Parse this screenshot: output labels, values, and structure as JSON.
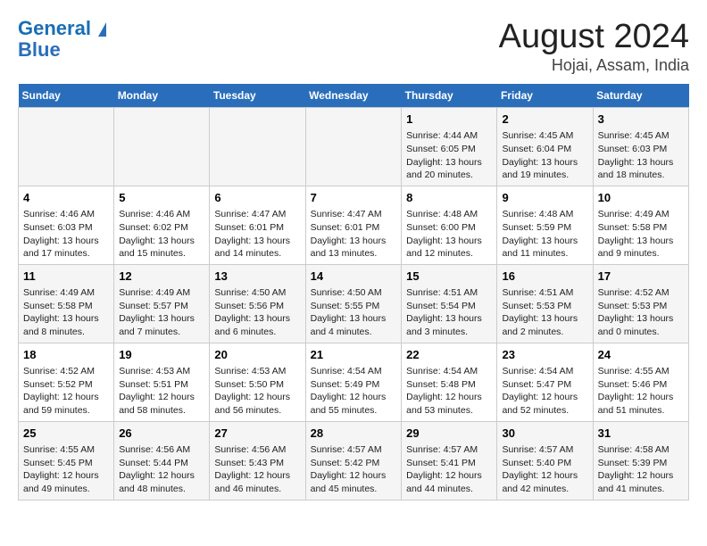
{
  "header": {
    "logo_line1": "General",
    "logo_line2": "Blue",
    "month": "August 2024",
    "location": "Hojai, Assam, India"
  },
  "weekdays": [
    "Sunday",
    "Monday",
    "Tuesday",
    "Wednesday",
    "Thursday",
    "Friday",
    "Saturday"
  ],
  "weeks": [
    [
      {
        "day": "",
        "info": ""
      },
      {
        "day": "",
        "info": ""
      },
      {
        "day": "",
        "info": ""
      },
      {
        "day": "",
        "info": ""
      },
      {
        "day": "1",
        "info": "Sunrise: 4:44 AM\nSunset: 6:05 PM\nDaylight: 13 hours\nand 20 minutes."
      },
      {
        "day": "2",
        "info": "Sunrise: 4:45 AM\nSunset: 6:04 PM\nDaylight: 13 hours\nand 19 minutes."
      },
      {
        "day": "3",
        "info": "Sunrise: 4:45 AM\nSunset: 6:03 PM\nDaylight: 13 hours\nand 18 minutes."
      }
    ],
    [
      {
        "day": "4",
        "info": "Sunrise: 4:46 AM\nSunset: 6:03 PM\nDaylight: 13 hours\nand 17 minutes."
      },
      {
        "day": "5",
        "info": "Sunrise: 4:46 AM\nSunset: 6:02 PM\nDaylight: 13 hours\nand 15 minutes."
      },
      {
        "day": "6",
        "info": "Sunrise: 4:47 AM\nSunset: 6:01 PM\nDaylight: 13 hours\nand 14 minutes."
      },
      {
        "day": "7",
        "info": "Sunrise: 4:47 AM\nSunset: 6:01 PM\nDaylight: 13 hours\nand 13 minutes."
      },
      {
        "day": "8",
        "info": "Sunrise: 4:48 AM\nSunset: 6:00 PM\nDaylight: 13 hours\nand 12 minutes."
      },
      {
        "day": "9",
        "info": "Sunrise: 4:48 AM\nSunset: 5:59 PM\nDaylight: 13 hours\nand 11 minutes."
      },
      {
        "day": "10",
        "info": "Sunrise: 4:49 AM\nSunset: 5:58 PM\nDaylight: 13 hours\nand 9 minutes."
      }
    ],
    [
      {
        "day": "11",
        "info": "Sunrise: 4:49 AM\nSunset: 5:58 PM\nDaylight: 13 hours\nand 8 minutes."
      },
      {
        "day": "12",
        "info": "Sunrise: 4:49 AM\nSunset: 5:57 PM\nDaylight: 13 hours\nand 7 minutes."
      },
      {
        "day": "13",
        "info": "Sunrise: 4:50 AM\nSunset: 5:56 PM\nDaylight: 13 hours\nand 6 minutes."
      },
      {
        "day": "14",
        "info": "Sunrise: 4:50 AM\nSunset: 5:55 PM\nDaylight: 13 hours\nand 4 minutes."
      },
      {
        "day": "15",
        "info": "Sunrise: 4:51 AM\nSunset: 5:54 PM\nDaylight: 13 hours\nand 3 minutes."
      },
      {
        "day": "16",
        "info": "Sunrise: 4:51 AM\nSunset: 5:53 PM\nDaylight: 13 hours\nand 2 minutes."
      },
      {
        "day": "17",
        "info": "Sunrise: 4:52 AM\nSunset: 5:53 PM\nDaylight: 13 hours\nand 0 minutes."
      }
    ],
    [
      {
        "day": "18",
        "info": "Sunrise: 4:52 AM\nSunset: 5:52 PM\nDaylight: 12 hours\nand 59 minutes."
      },
      {
        "day": "19",
        "info": "Sunrise: 4:53 AM\nSunset: 5:51 PM\nDaylight: 12 hours\nand 58 minutes."
      },
      {
        "day": "20",
        "info": "Sunrise: 4:53 AM\nSunset: 5:50 PM\nDaylight: 12 hours\nand 56 minutes."
      },
      {
        "day": "21",
        "info": "Sunrise: 4:54 AM\nSunset: 5:49 PM\nDaylight: 12 hours\nand 55 minutes."
      },
      {
        "day": "22",
        "info": "Sunrise: 4:54 AM\nSunset: 5:48 PM\nDaylight: 12 hours\nand 53 minutes."
      },
      {
        "day": "23",
        "info": "Sunrise: 4:54 AM\nSunset: 5:47 PM\nDaylight: 12 hours\nand 52 minutes."
      },
      {
        "day": "24",
        "info": "Sunrise: 4:55 AM\nSunset: 5:46 PM\nDaylight: 12 hours\nand 51 minutes."
      }
    ],
    [
      {
        "day": "25",
        "info": "Sunrise: 4:55 AM\nSunset: 5:45 PM\nDaylight: 12 hours\nand 49 minutes."
      },
      {
        "day": "26",
        "info": "Sunrise: 4:56 AM\nSunset: 5:44 PM\nDaylight: 12 hours\nand 48 minutes."
      },
      {
        "day": "27",
        "info": "Sunrise: 4:56 AM\nSunset: 5:43 PM\nDaylight: 12 hours\nand 46 minutes."
      },
      {
        "day": "28",
        "info": "Sunrise: 4:57 AM\nSunset: 5:42 PM\nDaylight: 12 hours\nand 45 minutes."
      },
      {
        "day": "29",
        "info": "Sunrise: 4:57 AM\nSunset: 5:41 PM\nDaylight: 12 hours\nand 44 minutes."
      },
      {
        "day": "30",
        "info": "Sunrise: 4:57 AM\nSunset: 5:40 PM\nDaylight: 12 hours\nand 42 minutes."
      },
      {
        "day": "31",
        "info": "Sunrise: 4:58 AM\nSunset: 5:39 PM\nDaylight: 12 hours\nand 41 minutes."
      }
    ]
  ]
}
